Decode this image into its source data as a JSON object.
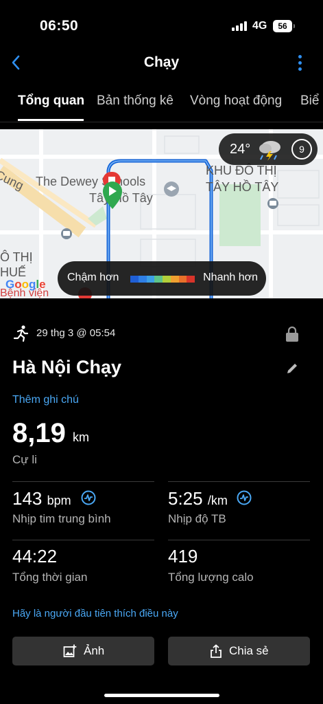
{
  "status_bar": {
    "time": "06:50",
    "network": "4G",
    "battery": "56"
  },
  "nav": {
    "title": "Chạy",
    "back_icon": "chevron-left-icon",
    "more_icon": "more-vertical-icon"
  },
  "tabs": [
    {
      "label": "Tổng quan",
      "active": true
    },
    {
      "label": "Bản thống kê"
    },
    {
      "label": "Vòng hoạt động"
    },
    {
      "label": "Biể"
    }
  ],
  "map": {
    "weather": {
      "temperature": "24°",
      "icon": "thunderstorm-icon",
      "wind": "9"
    },
    "labels": {
      "school_line1": "The Dewey Schools",
      "school_line2": "Tây Hồ Tây",
      "area_line1": "KHU ĐÔ THỊ",
      "area_line2": "TÂY HỒ TÂY",
      "left_line1": "Ô THỊ",
      "left_line2": "HUẾ",
      "road": "Cung",
      "hospital": "Bệnh viện"
    },
    "legend": {
      "slow": "Chậm hơn",
      "fast": "Nhanh hơn"
    },
    "pace_colors": [
      "#1f5fd6",
      "#2f7fe6",
      "#3da0e6",
      "#5ec48a",
      "#b3cf3a",
      "#f0a030",
      "#e8702a",
      "#d8342a"
    ],
    "route_color": "#1565d8",
    "attribution": "Google"
  },
  "activity": {
    "date": "29 thg 3 @ 05:54",
    "title": "Hà Nội Chạy",
    "add_note": "Thêm ghi chú",
    "distance": {
      "value": "8,19",
      "unit": "km",
      "label": "Cự li"
    },
    "stats": {
      "avg_hr": {
        "value": "143",
        "unit": "bpm",
        "label": "Nhịp tim trung bình"
      },
      "avg_pace": {
        "value": "5:25",
        "unit": "/km",
        "label": "Nhịp độ TB"
      },
      "total_time": {
        "value": "44:22",
        "label": "Tổng thời gian"
      },
      "calories": {
        "value": "419",
        "label": "Tổng lượng calo"
      }
    },
    "like_prompt": "Hãy là người đầu tiên thích điều này"
  },
  "buttons": {
    "photo": "Ảnh",
    "share": "Chia sẻ"
  },
  "colors": {
    "accent": "#4aa8f5",
    "background": "#000000",
    "button": "#333333"
  }
}
